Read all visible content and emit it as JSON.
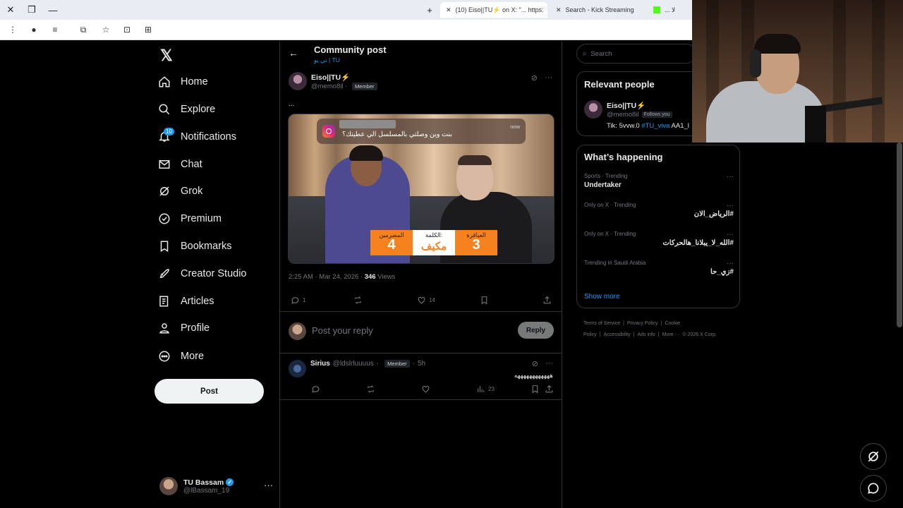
{
  "browser": {
    "tabs": [
      {
        "label": "(10) Eiso||TU⚡ on X: \"... https:",
        "active": true
      },
      {
        "label": "Search - Kick Streaming",
        "active": false
      },
      {
        "label": "... لا",
        "active": false
      }
    ]
  },
  "nav": {
    "items": [
      {
        "label": "Home",
        "icon": "home-icon"
      },
      {
        "label": "Explore",
        "icon": "search-icon"
      },
      {
        "label": "Notifications",
        "icon": "bell-icon",
        "badge": "10"
      },
      {
        "label": "Chat",
        "icon": "mail-icon"
      },
      {
        "label": "Grok",
        "icon": "grok-icon"
      },
      {
        "label": "Premium",
        "icon": "premium-icon"
      },
      {
        "label": "Bookmarks",
        "icon": "bookmark-icon"
      },
      {
        "label": "Creator Studio",
        "icon": "rocket-icon"
      },
      {
        "label": "Articles",
        "icon": "articles-icon"
      },
      {
        "label": "Profile",
        "icon": "person-icon"
      },
      {
        "label": "More",
        "icon": "more-circle-icon"
      }
    ],
    "post_label": "Post",
    "account": {
      "name": "TU Bassam",
      "handle": "@lBassam_19"
    }
  },
  "header": {
    "title": "Community post",
    "subtitle": "تي يو | TU"
  },
  "post": {
    "author_name": "Eiso||TU⚡",
    "author_handle": "@memo8il",
    "member_label": "Member",
    "text": "...",
    "media": {
      "notification_text": "بنت وين وصلتي بالمسلسل الي عطيتك؟",
      "notification_time": "now",
      "score": [
        {
          "label": "المضرمين",
          "value": "4"
        },
        {
          "label": "الكلمة:",
          "value": "مكيف"
        },
        {
          "label": "العباقرة",
          "value": "3"
        }
      ]
    },
    "time": "2:25 AM · Mar 24, 2026 · ",
    "views_count": "346",
    "views_label": " Views",
    "replies": "1",
    "likes": "14"
  },
  "reply_box": {
    "placeholder": "Post your reply",
    "button": "Reply"
  },
  "comment": {
    "name": "Sirius",
    "handle": "@ldslrluuuus",
    "member_label": "Member",
    "time": "5h",
    "text": "ههههههههههههه",
    "views": "23"
  },
  "sidebar": {
    "search_placeholder": "Search",
    "relevant_title": "Relevant people",
    "person": {
      "name": "Eiso||TU⚡",
      "handle": "@memo8il",
      "follows": "Follows you",
      "bio_prefix": "Tik: 5vvw.0 ",
      "bio_tag": "#TU_viva",
      "bio_suffix": " AA1_l"
    },
    "happening_title": "What’s happening",
    "trends": [
      {
        "meta": "Sports · Trending",
        "topic": "Undertaker",
        "rtl": false
      },
      {
        "meta": "Only on X · Trending",
        "topic": "#الرياض_الان",
        "rtl": true
      },
      {
        "meta": "Only on X · Trending",
        "topic": "#الله_لا_يبلانا_هالحركات",
        "rtl": true
      },
      {
        "meta": "Trending in Saudi Arabia",
        "topic": "#زي_حا",
        "rtl": true
      }
    ],
    "show_more": "Show more",
    "footer": [
      "Terms of Service",
      "|",
      "Privacy Policy",
      "|",
      "Cookie Policy",
      "|",
      "Accessibility",
      "|",
      "Ads info",
      "|",
      "More ···",
      "© 2026 X Corp."
    ]
  }
}
